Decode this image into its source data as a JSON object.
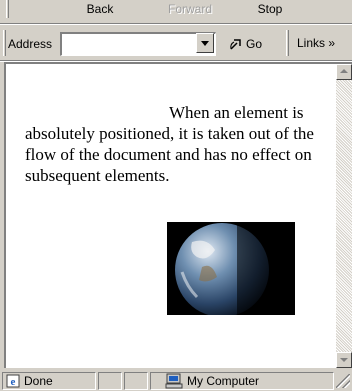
{
  "toolbar": {
    "back_label": "Back",
    "forward_label": "Forward",
    "stop_label": "Stop"
  },
  "address_bar": {
    "label": "Address",
    "value": "",
    "go_label": "Go",
    "links_label": "Links »"
  },
  "document": {
    "paragraph": "When an element is absolutely positioned, it is taken out of the flow of the document and has no effect on subsequent elements."
  },
  "status": {
    "state": "Done",
    "zone": "My Computer"
  },
  "colors": {
    "chrome": "#d4d0c8",
    "page_background": "#ffffff"
  }
}
